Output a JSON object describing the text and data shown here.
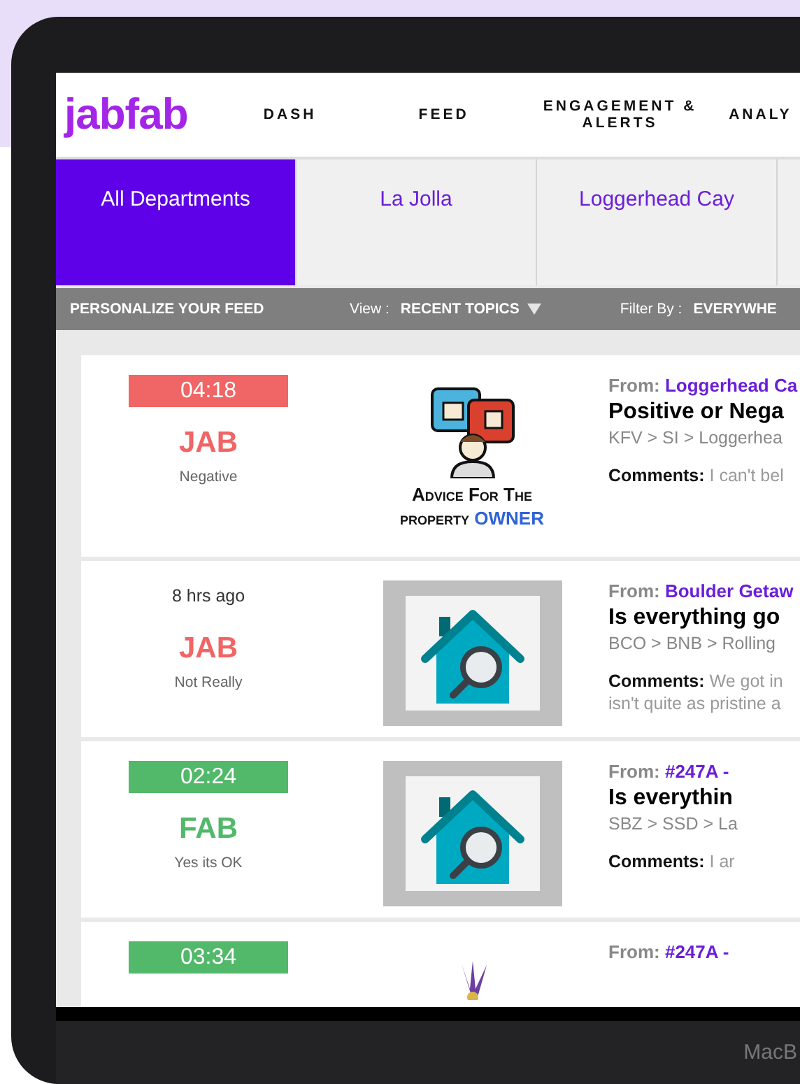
{
  "logo": "jabfab",
  "nav": [
    {
      "label": "DASH"
    },
    {
      "label": "FEED"
    },
    {
      "label": "ENGAGEMENT & ALERTS"
    },
    {
      "label": "ANALY"
    }
  ],
  "tabs": [
    {
      "label": "All Departments",
      "selected": true
    },
    {
      "label": "La Jolla",
      "selected": false
    },
    {
      "label": "Loggerhead Cay",
      "selected": false
    }
  ],
  "filter_bar": {
    "title": "PERSONALIZE YOUR FEED",
    "view_label": "View :",
    "view_value": "RECENT TOPICS",
    "filter_label": "Filter By :",
    "filter_value": "EVERYWHE"
  },
  "cards": [
    {
      "kind": "jab",
      "timer": "04:18",
      "verdict": "JAB",
      "sentiment": "Negative",
      "image": {
        "kind": "advice",
        "caption_lines": [
          "Advice For The",
          "property **OWNER**"
        ]
      },
      "from_label": "From:",
      "from": "Loggerhead Ca",
      "title": "Positive or Nega",
      "path": "KFV > SI > Loggerhea",
      "comments_label": "Comments:",
      "comment_lines": [
        "I can't bel"
      ]
    },
    {
      "kind": "jab",
      "time_ago": "8 hrs ago",
      "verdict": "JAB",
      "sentiment": "Not Really",
      "image": {
        "kind": "house"
      },
      "from_label": "From:",
      "from": "Boulder Getaw",
      "title": "Is everything go",
      "path": "BCO > BNB > Rolling",
      "comments_label": "Comments:",
      "comment_lines": [
        "We got in",
        "isn't quite as pristine a"
      ]
    },
    {
      "kind": "fab",
      "timer": "02:24",
      "verdict": "FAB",
      "sentiment": "Yes its OK",
      "image": {
        "kind": "house"
      },
      "from_label": "From:",
      "from": "#247A - ",
      "title": "Is everythin",
      "path": "SBZ > SSD > La",
      "comments_label": "Comments:",
      "comment_lines": [
        "I ar"
      ]
    },
    {
      "kind": "fab",
      "timer": "03:34",
      "image": {
        "kind": "flower"
      },
      "from_label": "From:",
      "from": "#247A - "
    }
  ],
  "device_label": "MacB"
}
